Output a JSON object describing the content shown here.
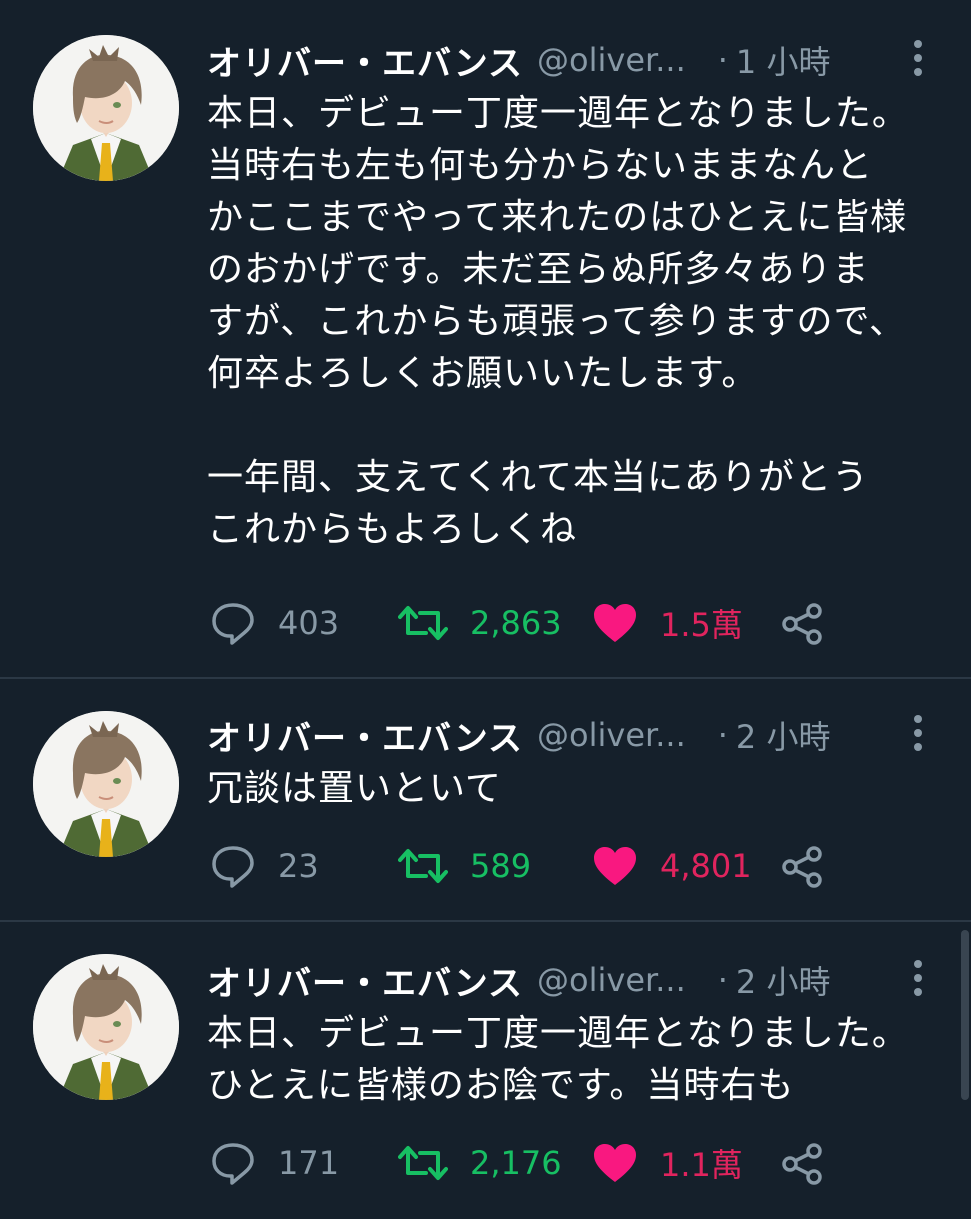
{
  "tweets": [
    {
      "name": "オリバー・エバンス",
      "handle": "@oliver...",
      "dot": "·",
      "time": "1 小時",
      "text": "本日、デビュー丁度一週年となりました。\n当時右も左も何も分からないままなんと\nかここまでやって来れたのはひとえに皆様\nのおかげです。未だ至らぬ所多々ありま\nすが、これからも頑張って参りますので、\n何卒よろしくお願いいたします。\n\n一年間、支えてくれて本当にありがとう\nこれからもよろしくね",
      "replies": "403",
      "retweets": "2,863",
      "likes": "1.5萬"
    },
    {
      "name": "オリバー・エバンス",
      "handle": "@oliver...",
      "dot": "·",
      "time": "2 小時",
      "text": "冗談は置いといて",
      "replies": "23",
      "retweets": "589",
      "likes": "4,801"
    },
    {
      "name": "オリバー・エバンス",
      "handle": "@oliver...",
      "dot": "·",
      "time": "2 小時",
      "text": "本日、デビュー丁度一週年となりました。\nひとえに皆様のお陰です。当時右も",
      "replies": "171",
      "retweets": "2,176",
      "likes": "1.1萬"
    }
  ],
  "icons": {
    "reply": "speech-bubble-icon",
    "retweet": "retweet-arrows-icon",
    "like": "heart-icon",
    "share": "share-nodes-icon",
    "more": "vertical-dots-icon"
  },
  "colors": {
    "background": "#15202b",
    "secondary_text": "#8899a6",
    "retweet": "#17bf63",
    "like": "#e0245e",
    "divider": "#2b3845"
  }
}
